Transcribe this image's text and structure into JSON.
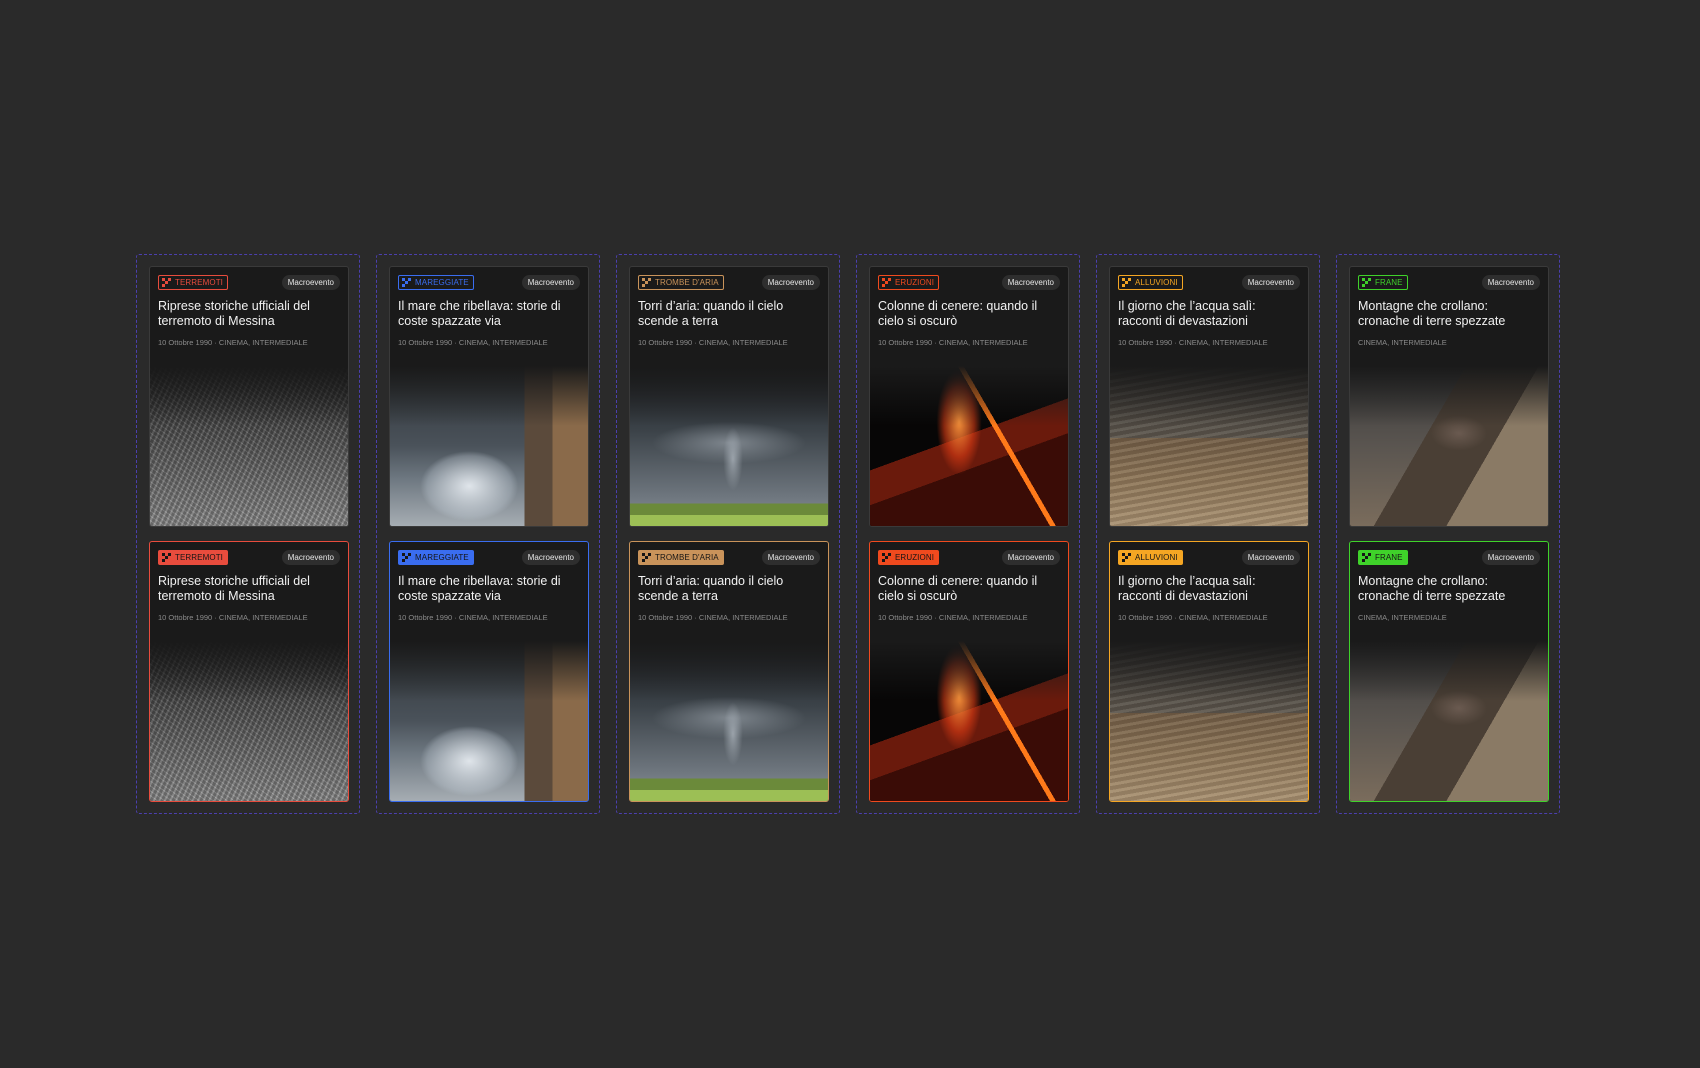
{
  "badge_label": "Macroevento",
  "rows": [
    "default",
    "hover"
  ],
  "cards": [
    {
      "tag": "TERREMOTI",
      "accent": "#e84c3d",
      "title": "Riprese storiche ufficiali del terremoto di Messina",
      "meta": "10 Ottobre 1990 · CINEMA, INTERMEDIALE",
      "image": "earthquake-ruins"
    },
    {
      "tag": "MAREGGIATE",
      "accent": "#3a6df0",
      "title": "Il mare che ribellava: storie di coste spazzate via",
      "meta": "10 Ottobre 1990 · CINEMA, INTERMEDIALE",
      "image": "storm-waves"
    },
    {
      "tag": "TROMBE D'ARIA",
      "accent": "#c9935a",
      "title": "Torri d’aria: quando il cielo scende a terra",
      "meta": "10 Ottobre 1990 · CINEMA, INTERMEDIALE",
      "image": "tornado"
    },
    {
      "tag": "ERUZIONI",
      "accent": "#f04a1e",
      "title": "Colonne di cenere: quando il cielo si oscurò",
      "meta": "10 Ottobre 1990 · CINEMA, INTERMEDIALE",
      "image": "volcano-eruption"
    },
    {
      "tag": "ALLUVIONI",
      "accent": "#f5a623",
      "title": "Il giorno che l’acqua salì: racconti di devastazioni",
      "meta": "10 Ottobre 1990 · CINEMA, INTERMEDIALE",
      "image": "flood"
    },
    {
      "tag": "FRANE",
      "accent": "#3fd22a",
      "title": "Montagne che crollano: cronache di terre spezzate",
      "meta": "CINEMA, INTERMEDIALE",
      "image": "landslide"
    }
  ]
}
